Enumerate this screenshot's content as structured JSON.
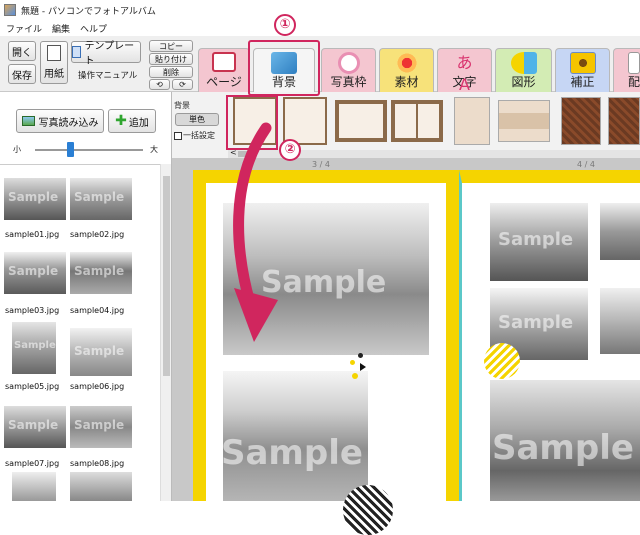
{
  "window": {
    "title": "無題 - パソコンでフォトアルバム"
  },
  "menu": [
    "ファイル",
    "編集",
    "ヘルプ"
  ],
  "toolbar": {
    "open": "開く",
    "save": "保存",
    "paper": "用紙",
    "template": "テンプレート",
    "manual": "操作マニュアル",
    "copy": "コピー",
    "paste": "貼り付け",
    "delete": "削除",
    "undo": "⟲",
    "redo": "⟳"
  },
  "tabs": [
    {
      "label": "ページ",
      "color": "#f4c6d0"
    },
    {
      "label": "背景",
      "color": "#f5f5f5"
    },
    {
      "label": "写真枠",
      "color": "#f4c6d0"
    },
    {
      "label": "素材",
      "color": "#f7e27a"
    },
    {
      "label": "文字",
      "color": "#f4c6d0"
    },
    {
      "label": "図形",
      "color": "#d3ecb4"
    },
    {
      "label": "補正",
      "color": "#c6d6f4"
    },
    {
      "label": "配",
      "color": "#f4c6d0"
    }
  ],
  "panel": {
    "load_button": "写真読み込み",
    "add_button": "追加",
    "size_small": "小",
    "size_large": "大",
    "zoom_level": 0.32
  },
  "photos": [
    {
      "name": "sample01.jpg"
    },
    {
      "name": "sample02.jpg"
    },
    {
      "name": "sample03.jpg"
    },
    {
      "name": "sample04.jpg"
    },
    {
      "name": "sample05.jpg"
    },
    {
      "name": "sample06.jpg"
    },
    {
      "name": "sample07.jpg"
    },
    {
      "name": "sample08.jpg"
    }
  ],
  "background": {
    "label": "背景",
    "color_button": "単色",
    "bulk_label": "一括設定"
  },
  "pages": {
    "left": "3 / 4",
    "right": "4 / 4"
  },
  "callouts": {
    "step1": "①",
    "step2": "②"
  },
  "watermark": "Sample",
  "colors": {
    "accent": "#d0265e",
    "page_border": "#f5d400",
    "right_page_border": "#5bc8c8"
  }
}
